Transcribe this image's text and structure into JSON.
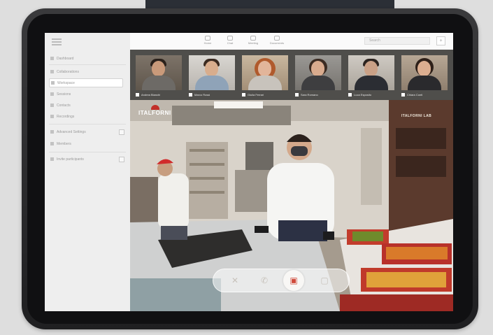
{
  "colors": {
    "background": "#dedede",
    "tablet_frame": "#2a2a2c",
    "sidebar": "#eeeeee",
    "strip": "#4f4e4b",
    "accent": "#d04a3b"
  },
  "sidebar": {
    "items": [
      {
        "label": "Dashboard",
        "icon": "home-icon"
      },
      {
        "label": "Collaborations",
        "icon": "list-icon"
      },
      {
        "label": "Workspace",
        "icon": "workspace-icon",
        "active": true
      },
      {
        "label": "Sessions",
        "icon": "session-icon"
      },
      {
        "label": "Contacts",
        "icon": "contacts-icon"
      },
      {
        "label": "Recordings",
        "icon": "record-icon"
      },
      {
        "label": "Advanced Settings",
        "icon": "settings-icon"
      },
      {
        "label": "Members",
        "icon": "user-icon"
      },
      {
        "label": "Invite participants",
        "icon": "invite-icon"
      }
    ]
  },
  "topbar": {
    "nav": [
      {
        "label": "Home",
        "icon": "home-icon"
      },
      {
        "label": "Chat",
        "icon": "chat-icon"
      },
      {
        "label": "Meeting",
        "icon": "meeting-icon"
      },
      {
        "label": "Documents",
        "icon": "document-icon"
      }
    ],
    "search_placeholder": "Search",
    "plus_label": "+"
  },
  "participants": [
    {
      "name": "Andrea Bianchi"
    },
    {
      "name": "Marco Rossi"
    },
    {
      "name": "Giulia Ferrari"
    },
    {
      "name": "Sara Romano"
    },
    {
      "name": "Luca Esposito"
    },
    {
      "name": "Chiara Conti"
    }
  ],
  "main_video": {
    "brand": "ITALFORNI",
    "wall_sign": "ITALFORNI LAB"
  },
  "controls": [
    {
      "name": "mic-off-button",
      "icon": "mic-off-icon",
      "glyph": "✕"
    },
    {
      "name": "call-button",
      "icon": "phone-icon",
      "glyph": "✆"
    },
    {
      "name": "camera-button",
      "icon": "camera-icon",
      "glyph": "▣"
    },
    {
      "name": "chat-button",
      "icon": "chat-icon",
      "glyph": "▢"
    }
  ]
}
